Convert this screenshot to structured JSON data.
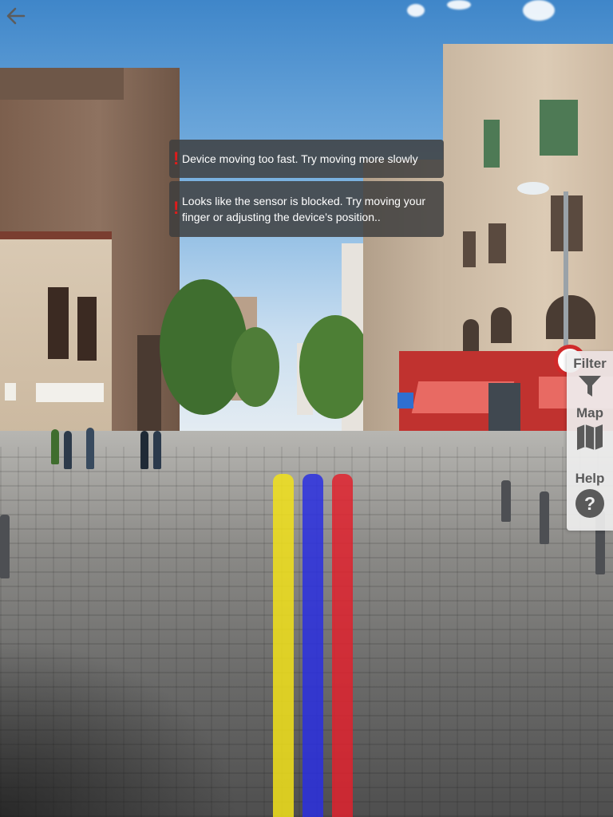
{
  "header": {
    "back_icon": "arrow-left-icon"
  },
  "notifications": [
    {
      "icon": "exclamation-icon",
      "message": "Device moving too fast. Try moving more slowly"
    },
    {
      "icon": "exclamation-icon",
      "message": "Looks like the sensor is blocked. Try moving your finger or adjusting the device’s position.."
    }
  ],
  "side_panel": {
    "items": [
      {
        "label": "Filter",
        "icon": "funnel-icon"
      },
      {
        "label": "Map",
        "icon": "folded-map-icon"
      },
      {
        "label": "Help",
        "icon": "question-circle-icon"
      }
    ]
  },
  "ar_paths": [
    {
      "name": "yellow-path",
      "color": "#f2e21a"
    },
    {
      "name": "blue-path",
      "color": "#2a2fe0"
    },
    {
      "name": "red-path",
      "color": "#e0222e"
    }
  ],
  "colors": {
    "toast_background": "#3e3e3e",
    "warning_accent": "#e11b1b",
    "panel_background": "#eeeeee",
    "panel_text": "#5a5a5a"
  }
}
